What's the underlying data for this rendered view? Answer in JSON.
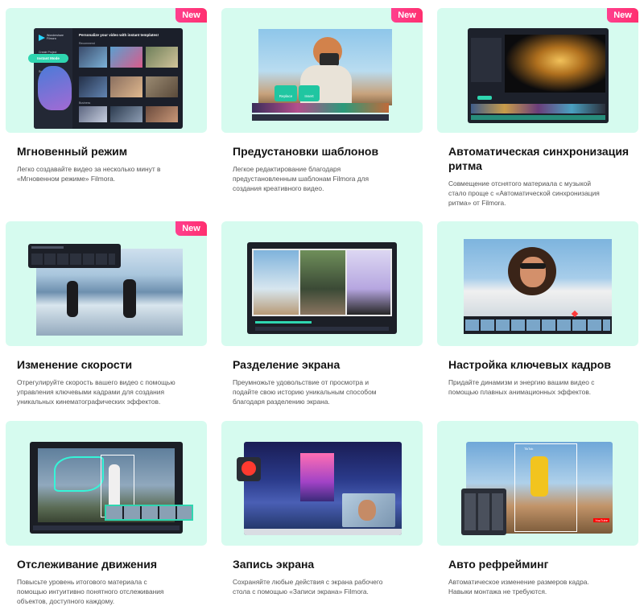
{
  "badge_label": "New",
  "colors": {
    "card_bg": "#d6fbef",
    "badge": "#ff2f6f",
    "accent": "#2fd6b0"
  },
  "cards": [
    {
      "title": "Мгновенный режим",
      "desc": "Легко создавайте видео за несколько минут в «Мгновенном режиме» Filmora.",
      "is_new": true,
      "ui": {
        "app_name": "Wondershare Filmora",
        "headline": "Personalize your video with instant templates!",
        "menu_create": "Create Project",
        "menu_instant": "Instant Mode",
        "menu_record": "Screen Recorder",
        "section_1": "Recommend",
        "section_2": "Business"
      }
    },
    {
      "title": "Предустановки шаблонов",
      "desc": "Легкое редактирование благодаря предустановленным шаблонам Filmora для создания креативного видео.",
      "is_new": true,
      "ui": {
        "replace_label": "Replace",
        "insert_label": "Insert"
      }
    },
    {
      "title": "Автоматическая синхронизация ритма",
      "desc": "Совмещение отснятого материала с музыкой стало проще с «Автоматической синхронизация ритма» от Filmora.",
      "is_new": true
    },
    {
      "title": "Изменение скорости",
      "desc": "Отрегулируйте скорость вашего видео с помощью управления ключевыми кадрами для создания уникальных кинематографических эффектов.",
      "is_new": true
    },
    {
      "title": "Разделение экрана",
      "desc": "Преумножьте удовольствие от просмотра и подайте свою историю уникальным способом благодаря разделению экрана.",
      "is_new": false
    },
    {
      "title": "Настройка ключевых кадров",
      "desc": "Придайте динамизм и энергию вашим видео с помощью плавных анимационных эффектов.",
      "is_new": false
    },
    {
      "title": "Отслеживание движения",
      "desc": "Повысьте уровень итогового материала с помощью интуитивно понятного отслеживания объектов, доступного каждому.",
      "is_new": false
    },
    {
      "title": "Запись экрана",
      "desc": "Сохраняйте любые действия с экрана рабочего стола с помощью «Записи экрана» Filmora.",
      "is_new": false
    },
    {
      "title": "Авто рефрейминг",
      "desc": "Автоматическое изменение размеров кадра. Навыки монтажа не требуются.",
      "is_new": false,
      "ui": {
        "platform_1": "TikTok",
        "platform_2": "YouTube"
      }
    }
  ]
}
